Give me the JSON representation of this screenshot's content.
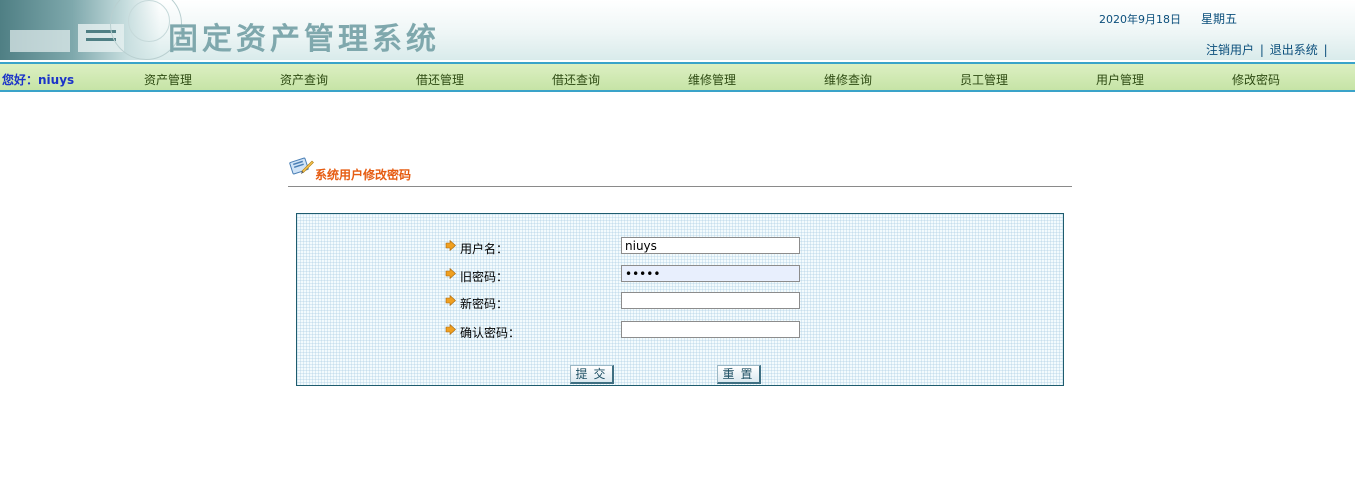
{
  "header": {
    "system_title": "固定资产管理系统",
    "date": "2020年9月18日",
    "weekday": "星期五",
    "links": [
      "注销用户",
      "退出系统"
    ],
    "separator": "|"
  },
  "nav": {
    "greeting": "您好：niuys",
    "items": [
      "资产管理",
      "资产查询",
      "借还管理",
      "借还查询",
      "维修管理",
      "维修查询",
      "员工管理",
      "用户管理",
      "修改密码"
    ]
  },
  "page": {
    "title": "系统用户修改密码"
  },
  "form": {
    "fields": [
      {
        "label": "用户名：",
        "value": "niuys",
        "type": "text"
      },
      {
        "label": "旧密码：",
        "value": "•••••",
        "type": "password"
      },
      {
        "label": "新密码：",
        "value": "",
        "type": "password"
      },
      {
        "label": "确认密码：",
        "value": "",
        "type": "password"
      }
    ],
    "submit_label": "提交",
    "reset_label": "重置"
  },
  "colors": {
    "nav_background": "#c6e4a6",
    "greeting_text": "#1b33c9",
    "page_title_text": "#e65c12",
    "panel_border": "#1e5c6e",
    "arrow_icon": "#f0a020"
  }
}
